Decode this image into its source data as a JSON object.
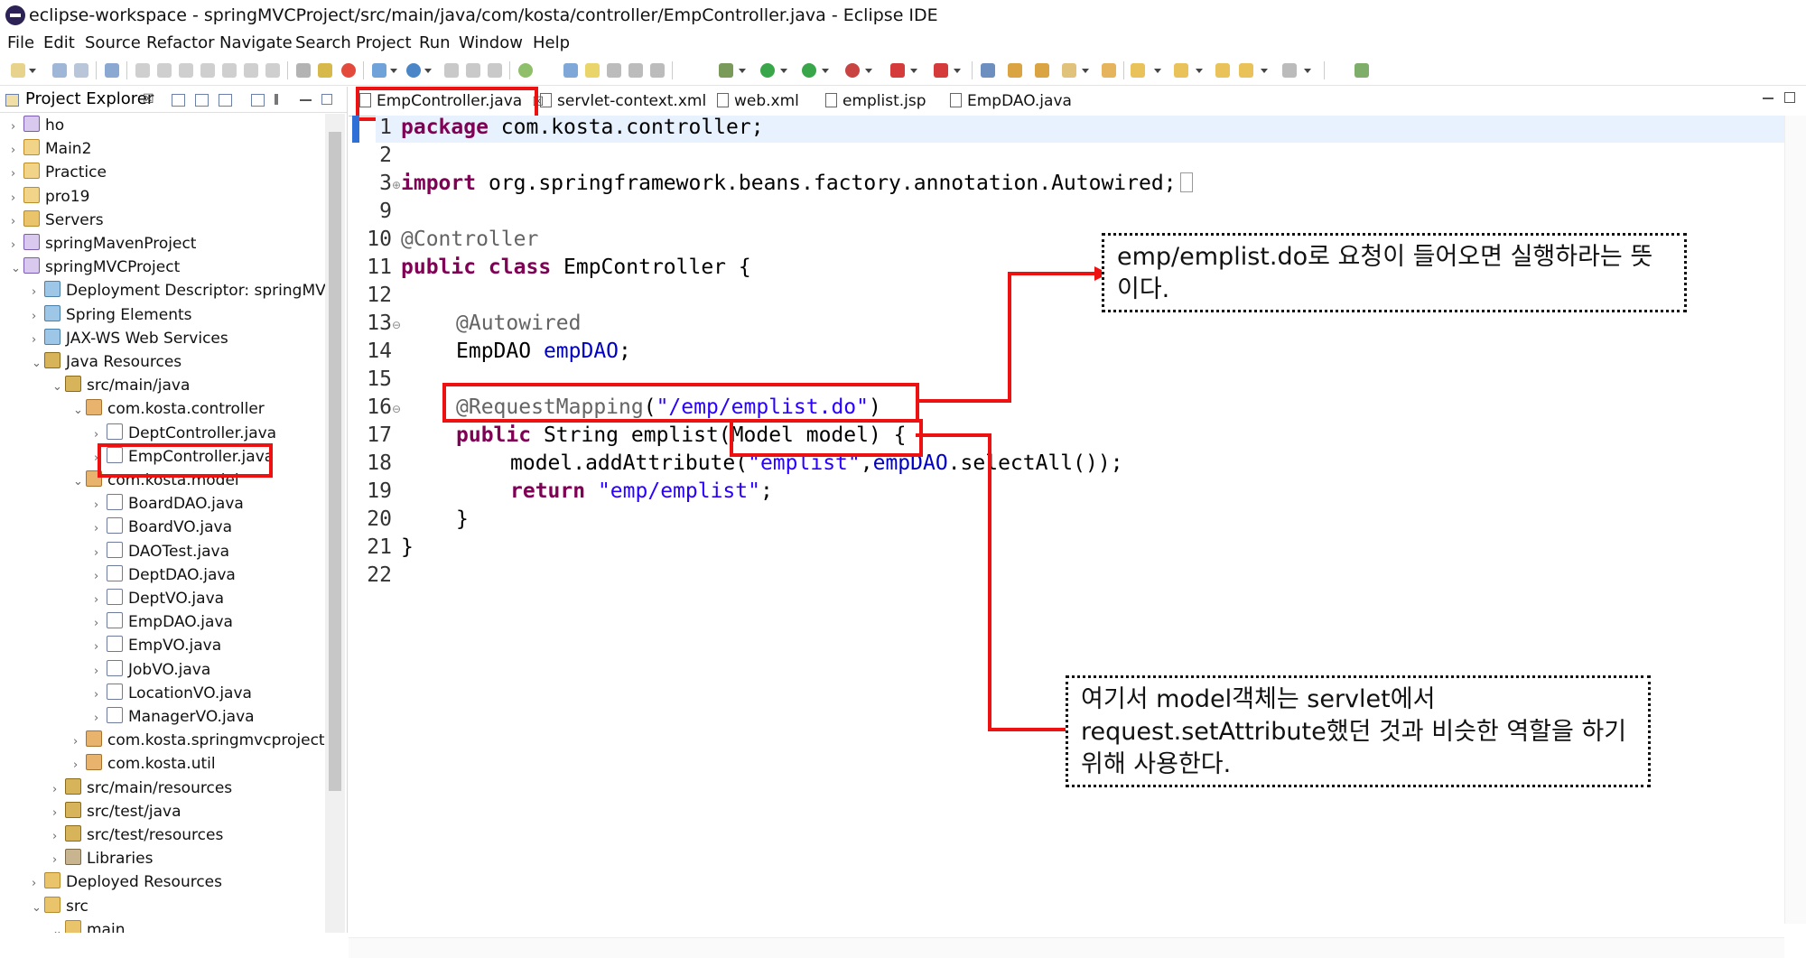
{
  "window": {
    "title": "eclipse-workspace - springMVCProject/src/main/java/com/kosta/controller/EmpController.java - Eclipse IDE"
  },
  "menu": [
    "File",
    "Edit",
    "Source",
    "Refactor",
    "Navigate",
    "Search",
    "Project",
    "Run",
    "Window",
    "Help"
  ],
  "explorer": {
    "title": "Project Explorer",
    "close": "☒",
    "items": [
      {
        "label": "ho",
        "icon": "web-project-icon",
        "expanded": false
      },
      {
        "label": "Main2",
        "icon": "project-icon",
        "expanded": false
      },
      {
        "label": "Practice",
        "icon": "project-icon",
        "expanded": false
      },
      {
        "label": "pro19",
        "icon": "project-icon",
        "expanded": false
      },
      {
        "label": "Servers",
        "icon": "folder-icon",
        "expanded": false
      },
      {
        "label": "springMavenProject",
        "icon": "web-project-icon",
        "expanded": false
      },
      {
        "label": "springMVCProject",
        "icon": "web-project-icon",
        "expanded": true
      },
      {
        "label": "Deployment Descriptor: springMVCP",
        "icon": "descriptor-icon",
        "expanded": false
      },
      {
        "label": "Spring Elements",
        "icon": "spring-icon",
        "expanded": false
      },
      {
        "label": "JAX-WS Web Services",
        "icon": "webservice-icon",
        "expanded": false
      },
      {
        "label": "Java Resources",
        "icon": "java-resources-icon",
        "expanded": true
      },
      {
        "label": "src/main/java",
        "icon": "source-folder-icon",
        "expanded": true
      },
      {
        "label": "com.kosta.controller",
        "icon": "package-icon",
        "expanded": true
      },
      {
        "label": "DeptController.java",
        "icon": "java-file-icon",
        "expanded": false
      },
      {
        "label": "EmpController.java",
        "icon": "java-file-icon",
        "expanded": false,
        "selected": true
      },
      {
        "label": "com.kosta.model",
        "icon": "package-icon",
        "expanded": true
      },
      {
        "label": "BoardDAO.java",
        "icon": "java-file-icon",
        "expanded": false
      },
      {
        "label": "BoardVO.java",
        "icon": "java-file-icon",
        "expanded": false
      },
      {
        "label": "DAOTest.java",
        "icon": "java-file-icon",
        "expanded": false
      },
      {
        "label": "DeptDAO.java",
        "icon": "java-file-icon",
        "expanded": false
      },
      {
        "label": "DeptVO.java",
        "icon": "java-file-icon",
        "expanded": false
      },
      {
        "label": "EmpDAO.java",
        "icon": "java-file-icon",
        "expanded": false
      },
      {
        "label": "EmpVO.java",
        "icon": "java-file-icon",
        "expanded": false
      },
      {
        "label": "JobVO.java",
        "icon": "java-file-icon",
        "expanded": false
      },
      {
        "label": "LocationVO.java",
        "icon": "java-file-icon",
        "expanded": false
      },
      {
        "label": "ManagerVO.java",
        "icon": "java-file-icon",
        "expanded": false
      },
      {
        "label": "com.kosta.springmvcproject",
        "icon": "package-icon",
        "expanded": false
      },
      {
        "label": "com.kosta.util",
        "icon": "package-icon",
        "expanded": false
      },
      {
        "label": "src/main/resources",
        "icon": "source-folder-icon",
        "expanded": false
      },
      {
        "label": "src/test/java",
        "icon": "source-folder-icon",
        "expanded": false
      },
      {
        "label": "src/test/resources",
        "icon": "source-folder-icon",
        "expanded": false
      },
      {
        "label": "Libraries",
        "icon": "library-icon",
        "expanded": false
      },
      {
        "label": "Deployed Resources",
        "icon": "folder-icon",
        "expanded": false
      },
      {
        "label": "src",
        "icon": "folder-icon",
        "expanded": true
      },
      {
        "label": "main",
        "icon": "folder-icon",
        "expanded": true
      }
    ]
  },
  "tabs": [
    {
      "label": "EmpController.java",
      "active": true,
      "close": "☒"
    },
    {
      "label": "servlet-context.xml"
    },
    {
      "label": "web.xml"
    },
    {
      "label": "emplist.jsp"
    },
    {
      "label": "EmpDAO.java"
    }
  ],
  "code": {
    "line_numbers": [
      "1",
      "2",
      "3",
      "9",
      "10",
      "11",
      "12",
      "13",
      "14",
      "15",
      "16",
      "17",
      "18",
      "19",
      "20",
      "21",
      "22"
    ],
    "l1_kw": "package",
    "l1_rest": " com.kosta.controller;",
    "l3_kw": "import",
    "l3_rest": " org.springframework.beans.factory.annotation.Autowired;",
    "l10_an": "@Controller",
    "l11_kw": "public class",
    "l11_rest": " EmpController {",
    "l13_an": "@Autowired",
    "l14_a": "EmpDAO ",
    "l14_fd": "empDAO",
    "l14_b": ";",
    "l16_an": "@RequestMapping",
    "l16_a": "(",
    "l16_st": "\"/emp/emplist.do\"",
    "l16_b": ")",
    "l17_kw": "public",
    "l17_rest": " String emplist(Model model) {",
    "l18_a": "model.addAttribute(",
    "l18_st": "\"emplist\"",
    "l18_b": ",",
    "l18_fd": "empDAO",
    "l18_c": ".selectAll());",
    "l19_kw": "return",
    "l19_sp": " ",
    "l19_st": "\"emp/emplist\"",
    "l19_b": ";",
    "l20": "}",
    "l21": "}"
  },
  "annotations": {
    "callout1": "emp/emplist.do로 요청이 들어오면 실행하라는 뜻이다.",
    "callout2": "여기서 model객체는 servlet에서 request.setAttribute했던 것과 비슷한 역할을 하기 위해 사용한다."
  },
  "colors": {
    "highlight_red": "#ee1111",
    "keyword": "#7f0055",
    "string": "#2a00ff",
    "field": "#0000c0",
    "annotation": "#646464"
  }
}
